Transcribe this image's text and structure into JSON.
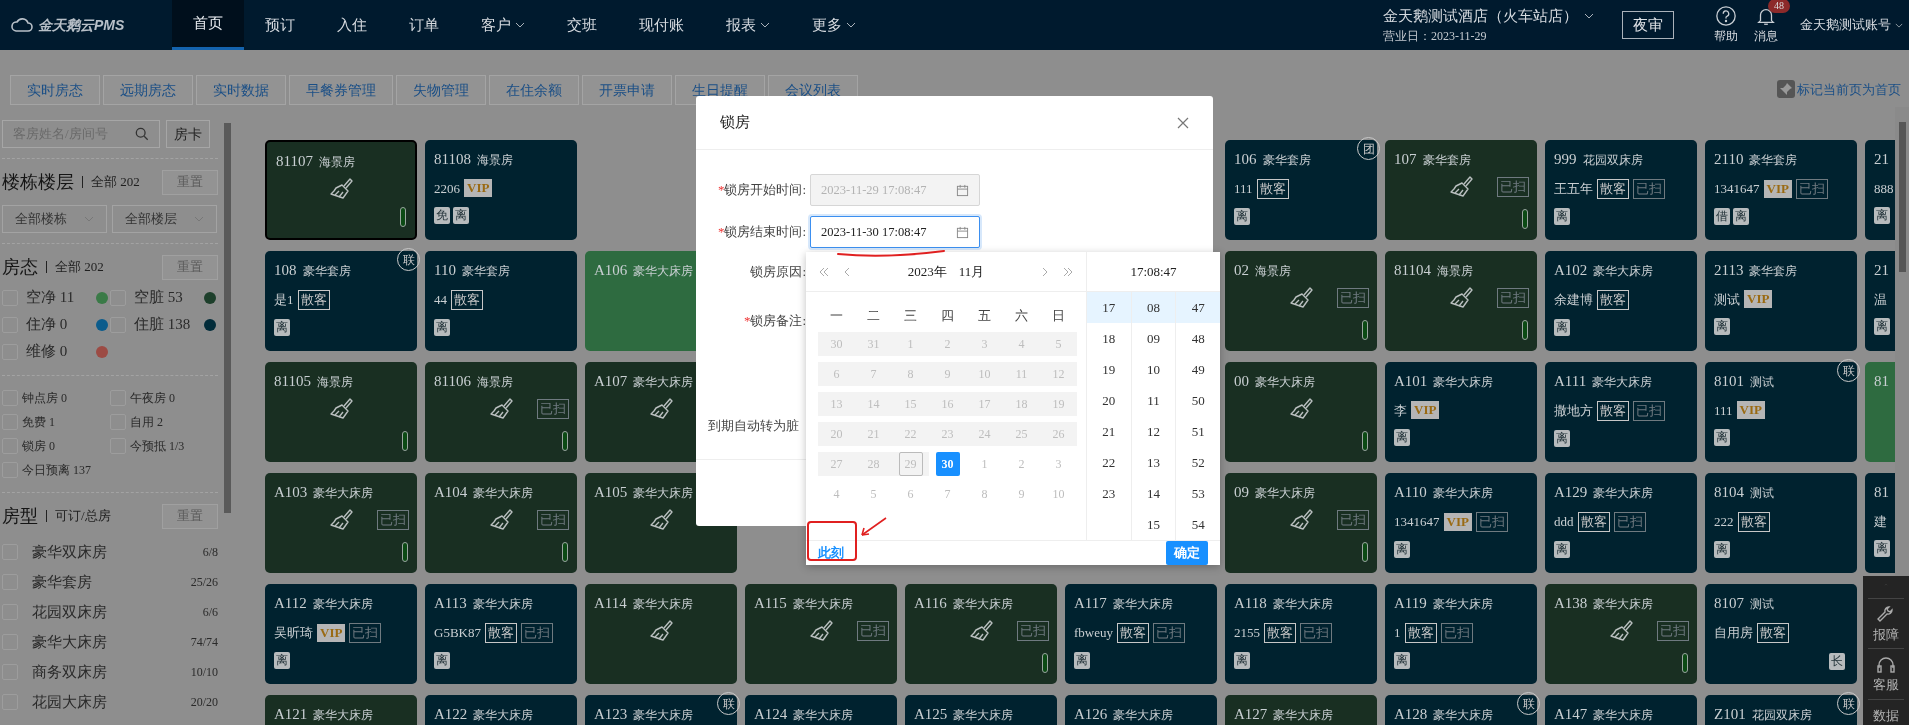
{
  "header": {
    "logo": "金天鹅云PMS",
    "nav": [
      {
        "label": "首页",
        "selected": true,
        "dropdown": false
      },
      {
        "label": "预订",
        "selected": false,
        "dropdown": false
      },
      {
        "label": "入住",
        "selected": false,
        "dropdown": false
      },
      {
        "label": "订单",
        "selected": false,
        "dropdown": false
      },
      {
        "label": "客户",
        "selected": false,
        "dropdown": true
      },
      {
        "label": "交班",
        "selected": false,
        "dropdown": false
      },
      {
        "label": "现付账",
        "selected": false,
        "dropdown": false
      },
      {
        "label": "报表",
        "selected": false,
        "dropdown": true
      },
      {
        "label": "更多",
        "selected": false,
        "dropdown": true
      }
    ],
    "hotel": "金天鹅测试酒店（火车站店）",
    "business_date": "营业日：2023-11-29",
    "night_audit": "夜审",
    "help": "帮助",
    "messages": "消息",
    "message_count": "48",
    "account": "金天鹅测试账号"
  },
  "tabs": [
    "实时房态",
    "远期房态",
    "实时数据",
    "早餐券管理",
    "失物管理",
    "在住余额",
    "开票申请",
    "生日提醒",
    "会议列表"
  ],
  "pin_home": "标记当前页为首页",
  "sidebar": {
    "search": {
      "placeholder": "客房姓名/房间号"
    },
    "card_button": "房卡",
    "building": {
      "title": "楼栋楼层",
      "summary": "全部 202",
      "reset": "重置",
      "selects": [
        "全部楼栋",
        "全部楼层"
      ]
    },
    "status": {
      "title": "房态",
      "summary": "全部 202",
      "reset": "重置",
      "items": [
        {
          "label": "空净 11",
          "color": "#3a7a47",
          "checked": false
        },
        {
          "label": "空脏 53",
          "color": "#1d3f2b",
          "checked": false
        },
        {
          "label": "住净 0",
          "color": "#0b5c8c",
          "checked": false
        },
        {
          "label": "住脏 138",
          "color": "#022c3a",
          "checked": false
        },
        {
          "label": "维修 0",
          "color": "#9c4b44",
          "checked": false
        }
      ]
    },
    "filters": [
      {
        "label": "钟点房 0",
        "checked": false
      },
      {
        "label": "午夜房 0",
        "checked": false
      },
      {
        "label": "免费 1",
        "checked": false
      },
      {
        "label": "自用 2",
        "checked": false
      },
      {
        "label": "锁房 0",
        "checked": false
      },
      {
        "label": "今预抵 1/3",
        "checked": false
      },
      {
        "label": "今日预离 137",
        "checked": false
      }
    ],
    "room_types": {
      "title": "房型",
      "summary": "可订/总房",
      "reset": "重置",
      "items": [
        {
          "label": "豪华双床房",
          "count": "6/8",
          "checked": false
        },
        {
          "label": "豪华套房",
          "count": "25/26",
          "checked": false
        },
        {
          "label": "花园双床房",
          "count": "6/6",
          "checked": false
        },
        {
          "label": "豪华大床房",
          "count": "74/74",
          "checked": false
        },
        {
          "label": "商务双床房",
          "count": "10/10",
          "checked": false
        },
        {
          "label": "花园大床房",
          "count": "20/20",
          "checked": false
        }
      ]
    }
  },
  "room_grid": [
    [
      {
        "kind": "vacant_dirty",
        "number": "81107",
        "type": "海景房",
        "selected": true,
        "indicator": true
      },
      {
        "kind": "occupied",
        "number": "81108",
        "type": "海景房",
        "guest": "2206",
        "badges": [
          {
            "kind": "vip",
            "label": "VIP"
          }
        ],
        "marks": [
          "免",
          "离"
        ],
        "selected": false,
        "indicator": false
      },
      {
        "kind": "empty"
      },
      {
        "kind": "empty"
      },
      {
        "kind": "empty"
      },
      {
        "kind": "empty"
      },
      {
        "kind": "occupied",
        "number": "106",
        "type": "豪华套房",
        "guest": "111",
        "badges": [
          {
            "kind": "source",
            "label": "散客"
          }
        ],
        "marks": [
          "离"
        ],
        "corner": "团",
        "selected": false,
        "indicator": false
      },
      {
        "kind": "vacant_dirty",
        "number": "107",
        "type": "豪华套房",
        "badges": [
          {
            "kind": "cleaned",
            "label": "已扫"
          }
        ],
        "selected": false,
        "indicator": true
      },
      {
        "kind": "occupied",
        "number": "999",
        "type": "花园双床房",
        "guest": "王五年",
        "badges": [
          {
            "kind": "source",
            "label": "散客"
          },
          {
            "kind": "cleaned",
            "label": "已扫"
          }
        ],
        "marks": [
          "离"
        ],
        "selected": false,
        "indicator": false
      },
      {
        "kind": "occupied",
        "number": "2110",
        "type": "豪华套房",
        "guest": "1341647",
        "badges": [
          {
            "kind": "vip",
            "label": "VIP"
          },
          {
            "kind": "cleaned",
            "label": "已扫"
          }
        ],
        "marks": [
          "借",
          "离"
        ],
        "selected": false,
        "indicator": false
      },
      {
        "kind": "occupied",
        "number": "21",
        "guest": "888",
        "marks": [
          "离"
        ],
        "selected": false,
        "indicator": false
      }
    ],
    [
      {
        "kind": "occupied",
        "number": "108",
        "type": "豪华套房",
        "guest": "是1",
        "badges": [
          {
            "kind": "source",
            "label": "散客"
          }
        ],
        "marks": [
          "离"
        ],
        "corner": "联",
        "selected": false,
        "indicator": false
      },
      {
        "kind": "occupied",
        "number": "110",
        "type": "豪华套房",
        "guest": "44",
        "badges": [
          {
            "kind": "source",
            "label": "散客"
          }
        ],
        "marks": [
          "离"
        ],
        "selected": false,
        "indicator": false
      },
      {
        "kind": "vacant_clean",
        "number": "A106",
        "type": "豪华大床房",
        "selected": false,
        "indicator": false
      },
      {
        "kind": "empty"
      },
      {
        "kind": "empty"
      },
      {
        "kind": "empty"
      },
      {
        "kind": "vacant_dirty",
        "number": "02",
        "type": "海景房",
        "badges": [
          {
            "kind": "cleaned",
            "label": "已扫"
          }
        ],
        "selected": false,
        "indicator": true
      },
      {
        "kind": "vacant_dirty",
        "number": "81104",
        "type": "海景房",
        "badges": [
          {
            "kind": "cleaned",
            "label": "已扫"
          }
        ],
        "selected": false,
        "indicator": true
      },
      {
        "kind": "occupied",
        "number": "A102",
        "type": "豪华大床房",
        "guest": "余建博",
        "badges": [
          {
            "kind": "source",
            "label": "散客"
          }
        ],
        "marks": [
          "离"
        ],
        "selected": false,
        "indicator": false
      },
      {
        "kind": "occupied",
        "number": "2113",
        "type": "豪华套房",
        "guest": "测试",
        "badges": [
          {
            "kind": "vip",
            "label": "VIP"
          }
        ],
        "marks": [
          "离"
        ],
        "selected": false,
        "indicator": false
      },
      {
        "kind": "occupied",
        "number": "21",
        "guest": "温",
        "marks": [
          "离"
        ],
        "selected": false,
        "indicator": false
      }
    ],
    [
      {
        "kind": "vacant_dirty",
        "number": "81105",
        "type": "海景房",
        "selected": false,
        "indicator": true
      },
      {
        "kind": "vacant_dirty",
        "number": "81106",
        "type": "海景房",
        "badges": [
          {
            "kind": "cleaned",
            "label": "已扫"
          }
        ],
        "selected": false,
        "indicator": true
      },
      {
        "kind": "vacant_dirty",
        "number": "A107",
        "type": "豪华大床房",
        "selected": false,
        "indicator": false
      },
      {
        "kind": "empty"
      },
      {
        "kind": "empty"
      },
      {
        "kind": "empty"
      },
      {
        "kind": "vacant_dirty",
        "number": "00",
        "type": "豪华大床房",
        "selected": false,
        "indicator": true
      },
      {
        "kind": "occupied",
        "number": "A101",
        "type": "豪华大床房",
        "guest": "李",
        "badges": [
          {
            "kind": "vip",
            "label": "VIP"
          }
        ],
        "marks": [
          "离"
        ],
        "selected": false,
        "indicator": false
      },
      {
        "kind": "occupied",
        "number": "A111",
        "type": "豪华大床房",
        "guest": "撒地方",
        "badges": [
          {
            "kind": "source",
            "label": "散客"
          },
          {
            "kind": "cleaned",
            "label": "已扫"
          }
        ],
        "marks": [
          "离"
        ],
        "selected": false,
        "indicator": false
      },
      {
        "kind": "occupied",
        "number": "8101",
        "type": "测试",
        "guest": "111",
        "badges": [
          {
            "kind": "vip",
            "label": "VIP"
          }
        ],
        "marks": [
          "离"
        ],
        "corner": "联",
        "selected": false,
        "indicator": false
      },
      {
        "kind": "vacant_clean",
        "number": "81",
        "selected": false,
        "indicator": false
      }
    ],
    [
      {
        "kind": "vacant_dirty",
        "number": "A103",
        "type": "豪华大床房",
        "badges": [
          {
            "kind": "cleaned",
            "label": "已扫"
          }
        ],
        "selected": false,
        "indicator": true
      },
      {
        "kind": "vacant_dirty",
        "number": "A104",
        "type": "豪华大床房",
        "badges": [
          {
            "kind": "cleaned",
            "label": "已扫"
          }
        ],
        "selected": false,
        "indicator": true
      },
      {
        "kind": "vacant_dirty",
        "number": "A105",
        "type": "豪华大床房",
        "selected": false,
        "indicator": false
      },
      {
        "kind": "empty"
      },
      {
        "kind": "empty"
      },
      {
        "kind": "empty"
      },
      {
        "kind": "vacant_dirty",
        "number": "09",
        "type": "豪华大床房",
        "badges": [
          {
            "kind": "cleaned",
            "label": "已扫"
          }
        ],
        "selected": false,
        "indicator": true
      },
      {
        "kind": "occupied",
        "number": "A110",
        "type": "豪华大床房",
        "guest": "1341647",
        "badges": [
          {
            "kind": "vip",
            "label": "VIP"
          },
          {
            "kind": "cleaned",
            "label": "已扫"
          }
        ],
        "marks": [
          "离"
        ],
        "selected": false,
        "indicator": false
      },
      {
        "kind": "occupied",
        "number": "A129",
        "type": "豪华大床房",
        "guest": "ddd",
        "badges": [
          {
            "kind": "source",
            "label": "散客"
          },
          {
            "kind": "cleaned",
            "label": "已扫"
          }
        ],
        "marks": [
          "离"
        ],
        "selected": false,
        "indicator": false
      },
      {
        "kind": "occupied",
        "number": "8104",
        "type": "测试",
        "guest": "222",
        "badges": [
          {
            "kind": "source",
            "label": "散客"
          }
        ],
        "marks": [
          "离"
        ],
        "selected": false,
        "indicator": false
      },
      {
        "kind": "occupied",
        "number": "81",
        "guest": "建",
        "marks": [
          "离"
        ],
        "selected": false,
        "indicator": false
      }
    ],
    [
      {
        "kind": "occupied",
        "number": "A112",
        "type": "豪华大床房",
        "guest": "吴昕琦",
        "badges": [
          {
            "kind": "vip",
            "label": "VIP"
          },
          {
            "kind": "cleaned",
            "label": "已扫"
          }
        ],
        "marks": [
          "离"
        ],
        "selected": false,
        "indicator": false
      },
      {
        "kind": "occupied",
        "number": "A113",
        "type": "豪华大床房",
        "guest": "G5BK87",
        "badges": [
          {
            "kind": "source",
            "label": "散客"
          },
          {
            "kind": "cleaned",
            "label": "已扫"
          }
        ],
        "marks": [
          "离"
        ],
        "selected": false,
        "indicator": false
      },
      {
        "kind": "vacant_dirty",
        "number": "A114",
        "type": "豪华大床房",
        "selected": false,
        "indicator": false
      },
      {
        "kind": "vacant_dirty",
        "number": "A115",
        "type": "豪华大床房",
        "badges": [
          {
            "kind": "cleaned",
            "label": "已扫"
          }
        ],
        "selected": false,
        "indicator": false
      },
      {
        "kind": "vacant_dirty",
        "number": "A116",
        "type": "豪华大床房",
        "badges": [
          {
            "kind": "cleaned",
            "label": "已扫"
          }
        ],
        "selected": false,
        "indicator": true
      },
      {
        "kind": "occupied",
        "number": "A117",
        "type": "豪华大床房",
        "guest": "fbweuy",
        "badges": [
          {
            "kind": "source",
            "label": "散客"
          },
          {
            "kind": "cleaned",
            "label": "已扫"
          }
        ],
        "marks": [
          "离"
        ],
        "selected": false,
        "indicator": false
      },
      {
        "kind": "occupied",
        "number": "A118",
        "type": "豪华大床房",
        "guest": "2155",
        "badges": [
          {
            "kind": "source",
            "label": "散客"
          },
          {
            "kind": "cleaned",
            "label": "已扫"
          }
        ],
        "marks": [
          "离"
        ],
        "selected": false,
        "indicator": false
      },
      {
        "kind": "occupied",
        "number": "A119",
        "type": "豪华大床房",
        "guest": "1",
        "badges": [
          {
            "kind": "source",
            "label": "散客"
          },
          {
            "kind": "cleaned",
            "label": "已扫"
          }
        ],
        "marks": [
          "离"
        ],
        "selected": false,
        "indicator": false
      },
      {
        "kind": "vacant_dirty",
        "number": "A138",
        "type": "豪华大床房",
        "badges": [
          {
            "kind": "cleaned",
            "label": "已扫"
          }
        ],
        "selected": false,
        "indicator": true
      },
      {
        "kind": "occupied",
        "number": "8107",
        "type": "测试",
        "guest": "自用房",
        "badges": [
          {
            "kind": "source",
            "label": "散客"
          }
        ],
        "stay": "长",
        "selected": false,
        "indicator": false
      },
      {
        "kind": "empty"
      }
    ],
    [
      {
        "kind": "vacant_dirty",
        "number": "A121",
        "type": "豪华大床房",
        "selected": false,
        "indicator": false
      },
      {
        "kind": "occupied",
        "number": "A122",
        "type": "豪华大床房",
        "selected": false,
        "indicator": false
      },
      {
        "kind": "occupied",
        "number": "A123",
        "type": "豪华大床房",
        "corner": "联",
        "selected": false,
        "indicator": false
      },
      {
        "kind": "occupied",
        "number": "A124",
        "type": "豪华大床房",
        "selected": false,
        "indicator": false
      },
      {
        "kind": "occupied",
        "number": "A125",
        "type": "豪华大床房",
        "selected": false,
        "indicator": false
      },
      {
        "kind": "occupied",
        "number": "A126",
        "type": "豪华大床房",
        "selected": false,
        "indicator": false
      },
      {
        "kind": "vacant_dirty",
        "number": "A127",
        "type": "豪华大床房",
        "selected": false,
        "indicator": false
      },
      {
        "kind": "occupied",
        "number": "A128",
        "type": "豪华大床房",
        "corner": "联",
        "selected": false,
        "indicator": false
      },
      {
        "kind": "occupied",
        "number": "A147",
        "type": "豪华大床房",
        "selected": false,
        "indicator": false
      },
      {
        "kind": "occupied",
        "number": "Z101",
        "type": "花园双床房",
        "corner": "联",
        "selected": false,
        "indicator": false
      },
      {
        "kind": "empty"
      }
    ]
  ],
  "side_tools": [
    {
      "kind": "top"
    },
    {
      "kind": "repair",
      "label": "报障"
    },
    {
      "kind": "service",
      "label": "客服"
    },
    {
      "kind": "data",
      "label": "数据"
    }
  ],
  "dialog": {
    "title": "锁房",
    "fields": [
      {
        "label": "锁房开始时间:",
        "required_mark": "*",
        "value": "2023-11-29 17:08:47",
        "disabled": true,
        "focused": false
      },
      {
        "label": "锁房结束时间:",
        "required_mark": "*",
        "value": "2023-11-30 17:08:47",
        "disabled": false,
        "focused": true
      }
    ],
    "reason_label": "锁房原因:",
    "remark_label": "锁房备注:",
    "remark_required_mark": "*",
    "auto_dirty_label": "到期自动转为脏"
  },
  "date_picker": {
    "year": "2023年",
    "month": "11月",
    "time": "17:08:47",
    "weekdays": [
      "一",
      "二",
      "三",
      "四",
      "五",
      "六",
      "日"
    ],
    "days": [
      {
        "day": "30",
        "kind": "past",
        "today": false,
        "selected": false
      },
      {
        "day": "31",
        "kind": "past",
        "today": false,
        "selected": false
      },
      {
        "day": "1",
        "kind": "past",
        "today": false,
        "selected": false
      },
      {
        "day": "2",
        "kind": "past",
        "today": false,
        "selected": false
      },
      {
        "day": "3",
        "kind": "past",
        "today": false,
        "selected": false
      },
      {
        "day": "4",
        "kind": "past",
        "today": false,
        "selected": false
      },
      {
        "day": "5",
        "kind": "past",
        "today": false,
        "selected": false
      },
      {
        "day": "6",
        "kind": "past",
        "today": false,
        "selected": false
      },
      {
        "day": "7",
        "kind": "past",
        "today": false,
        "selected": false
      },
      {
        "day": "8",
        "kind": "past",
        "today": false,
        "selected": false
      },
      {
        "day": "9",
        "kind": "past",
        "today": false,
        "selected": false
      },
      {
        "day": "10",
        "kind": "past",
        "today": false,
        "selected": false
      },
      {
        "day": "11",
        "kind": "past",
        "today": false,
        "selected": false
      },
      {
        "day": "12",
        "kind": "past",
        "today": false,
        "selected": false
      },
      {
        "day": "13",
        "kind": "past",
        "today": false,
        "selected": false
      },
      {
        "day": "14",
        "kind": "past",
        "today": false,
        "selected": false
      },
      {
        "day": "15",
        "kind": "past",
        "today": false,
        "selected": false
      },
      {
        "day": "16",
        "kind": "past",
        "today": false,
        "selected": false
      },
      {
        "day": "17",
        "kind": "past",
        "today": false,
        "selected": false
      },
      {
        "day": "18",
        "kind": "past",
        "today": false,
        "selected": false
      },
      {
        "day": "19",
        "kind": "past",
        "today": false,
        "selected": false
      },
      {
        "day": "20",
        "kind": "past",
        "today": false,
        "selected": false
      },
      {
        "day": "21",
        "kind": "past",
        "today": false,
        "selected": false
      },
      {
        "day": "22",
        "kind": "past",
        "today": false,
        "selected": false
      },
      {
        "day": "23",
        "kind": "past",
        "today": false,
        "selected": false
      },
      {
        "day": "24",
        "kind": "past",
        "today": false,
        "selected": false
      },
      {
        "day": "25",
        "kind": "past",
        "today": false,
        "selected": false
      },
      {
        "day": "26",
        "kind": "past",
        "today": false,
        "selected": false
      },
      {
        "day": "27",
        "kind": "past",
        "today": false,
        "selected": false
      },
      {
        "day": "28",
        "kind": "past",
        "today": false,
        "selected": false
      },
      {
        "day": "29",
        "kind": "past",
        "today": true,
        "selected": false
      },
      {
        "day": "30",
        "kind": "current",
        "today": false,
        "selected": true
      },
      {
        "day": "1",
        "kind": "next",
        "today": false,
        "selected": false
      },
      {
        "day": "2",
        "kind": "next",
        "today": false,
        "selected": false
      },
      {
        "day": "3",
        "kind": "next",
        "today": false,
        "selected": false
      },
      {
        "day": "4",
        "kind": "next",
        "today": false,
        "selected": false
      },
      {
        "day": "5",
        "kind": "next",
        "today": false,
        "selected": false
      },
      {
        "day": "6",
        "kind": "next",
        "today": false,
        "selected": false
      },
      {
        "day": "7",
        "kind": "next",
        "today": false,
        "selected": false
      },
      {
        "day": "8",
        "kind": "next",
        "today": false,
        "selected": false
      },
      {
        "day": "9",
        "kind": "next",
        "today": false,
        "selected": false
      },
      {
        "day": "10",
        "kind": "next",
        "today": false,
        "selected": false
      }
    ],
    "hours": [
      {
        "label": "17",
        "selected": true
      },
      {
        "label": "18",
        "selected": false
      },
      {
        "label": "19",
        "selected": false
      },
      {
        "label": "20",
        "selected": false
      },
      {
        "label": "21",
        "selected": false
      },
      {
        "label": "22",
        "selected": false
      },
      {
        "label": "23",
        "selected": false
      }
    ],
    "minutes": [
      {
        "label": "08",
        "selected": true
      },
      {
        "label": "09",
        "selected": false
      },
      {
        "label": "10",
        "selected": false
      },
      {
        "label": "11",
        "selected": false
      },
      {
        "label": "12",
        "selected": false
      },
      {
        "label": "13",
        "selected": false
      },
      {
        "label": "14",
        "selected": false
      },
      {
        "label": "15",
        "selected": false
      }
    ],
    "seconds": [
      {
        "label": "47",
        "selected": true
      },
      {
        "label": "48",
        "selected": false
      },
      {
        "label": "49",
        "selected": false
      },
      {
        "label": "50",
        "selected": false
      },
      {
        "label": "51",
        "selected": false
      },
      {
        "label": "52",
        "selected": false
      },
      {
        "label": "53",
        "selected": false
      },
      {
        "label": "54",
        "selected": false
      }
    ],
    "now_button": "此刻",
    "ok_button": "确定"
  }
}
